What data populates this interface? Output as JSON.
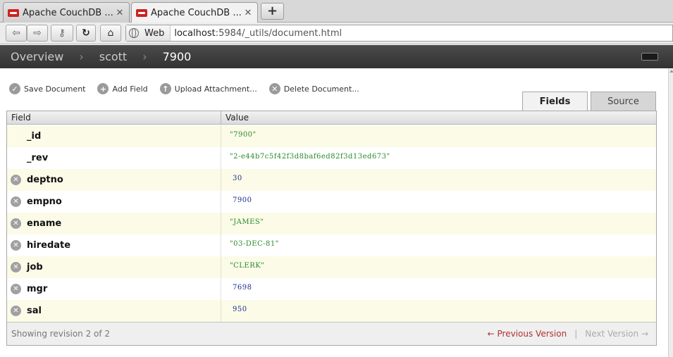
{
  "browser": {
    "tabs": [
      {
        "title": "Apache CouchDB ...",
        "active": false
      },
      {
        "title": "Apache CouchDB ...",
        "active": true
      }
    ],
    "new_tab_label": "+",
    "url_chip": "Web",
    "url_host": "localhost",
    "url_rest": ":5984/_utils/document.html"
  },
  "breadcrumb": {
    "items": [
      "Overview",
      "scott",
      "7900"
    ],
    "separator": "›"
  },
  "toolbar": {
    "save": "Save Document",
    "add_field": "Add Field",
    "upload": "Upload Attachment...",
    "delete": "Delete Document..."
  },
  "view_tabs": {
    "fields": "Fields",
    "source": "Source"
  },
  "table": {
    "headers": {
      "field": "Field",
      "value": "Value"
    },
    "rows": [
      {
        "field": "_id",
        "value": "\"7900\"",
        "kind": "str",
        "deletable": false
      },
      {
        "field": "_rev",
        "value": "\"2-e44b7c5f42f3d8baf6ed82f3d13ed673\"",
        "kind": "str",
        "deletable": false
      },
      {
        "field": "deptno",
        "value": "30",
        "kind": "num",
        "deletable": true
      },
      {
        "field": "empno",
        "value": "7900",
        "kind": "num",
        "deletable": true
      },
      {
        "field": "ename",
        "value": "\"JAMES\"",
        "kind": "str",
        "deletable": true
      },
      {
        "field": "hiredate",
        "value": "\"03-DEC-81\"",
        "kind": "str",
        "deletable": true
      },
      {
        "field": "job",
        "value": "\"CLERK\"",
        "kind": "str",
        "deletable": true
      },
      {
        "field": "mgr",
        "value": "7698",
        "kind": "num",
        "deletable": true
      },
      {
        "field": "sal",
        "value": "950",
        "kind": "num",
        "deletable": true
      }
    ],
    "footer": {
      "revision_info": "Showing revision 2 of 2",
      "previous": "← Previous Version",
      "separator": "|",
      "next": "Next Version →"
    }
  },
  "colors": {
    "header_bg": "#3d3d3d",
    "odd_row": "#fbfbe8",
    "string_value": "#2a8a2a",
    "number_value": "#1a2e8a",
    "prev_link": "#b03030"
  }
}
